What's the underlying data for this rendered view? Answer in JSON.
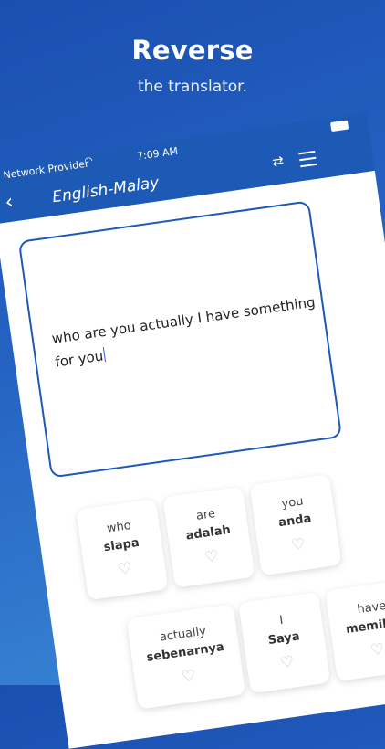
{
  "promo": {
    "headline": "Reverse",
    "subline": "the translator."
  },
  "status_bar": {
    "carrier": "Network Provider",
    "time": "7:09 AM"
  },
  "app_bar": {
    "title": "English-Malay"
  },
  "input": {
    "text": "who are you actually I have something for you"
  },
  "words": [
    {
      "en": "who",
      "ms": "siapa"
    },
    {
      "en": "are",
      "ms": "adalah"
    },
    {
      "en": "you",
      "ms": "anda"
    },
    {
      "en": "actually",
      "ms": "sebenarnya"
    },
    {
      "en": "I",
      "ms": "Saya"
    },
    {
      "en": "have",
      "ms": "memiliki"
    }
  ],
  "colors": {
    "primary": "#1d5ab6",
    "background_top": "#1a4fb0",
    "background_bottom": "#3b8ad6"
  }
}
